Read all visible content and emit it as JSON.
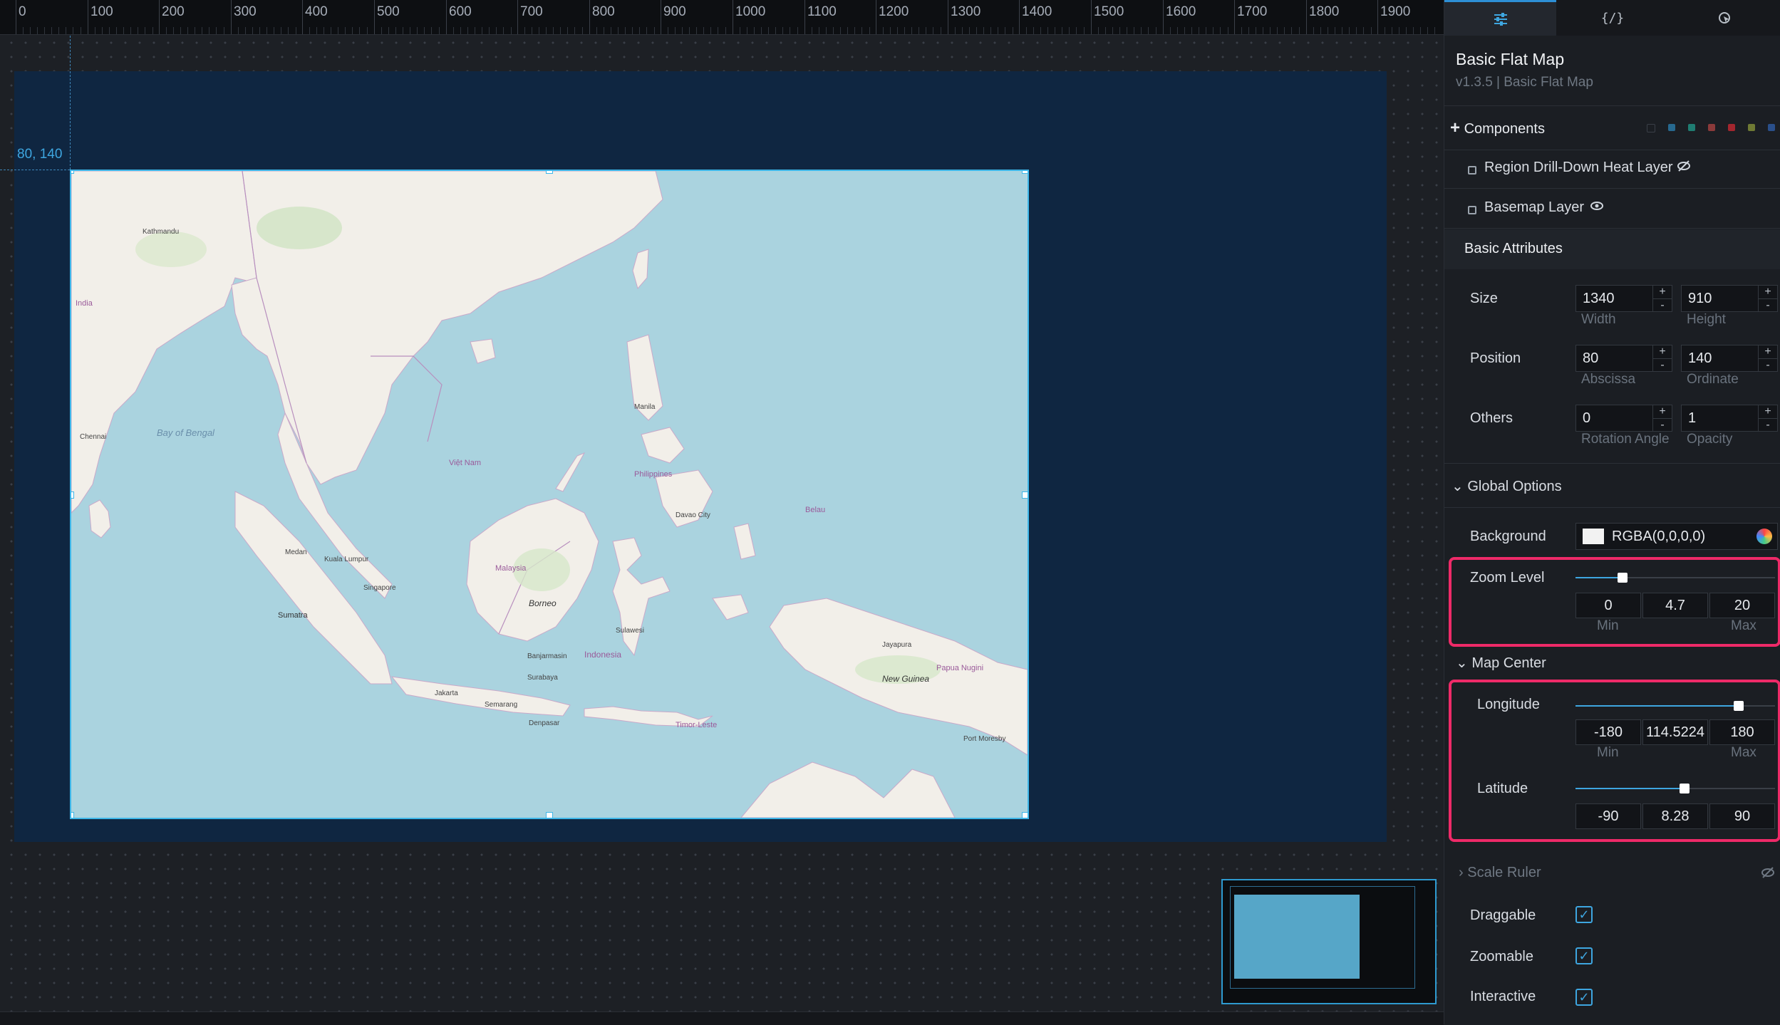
{
  "ruler": {
    "ticks": [
      "0",
      "100",
      "200",
      "300",
      "400",
      "500",
      "600",
      "700",
      "800",
      "900",
      "1000",
      "1100",
      "1200",
      "1300",
      "1400",
      "1500",
      "1600",
      "1700",
      "1800",
      "1900"
    ]
  },
  "canvas": {
    "selection_coords": "80, 140"
  },
  "map_labels": {
    "bay_of_bengal": "Bay of Bengal",
    "borneo": "Borneo",
    "malaysia": "Malaysia",
    "indonesia": "Indonesia",
    "new_guinea": "New Guinea",
    "papua_nugini": "Papua Nugini",
    "philippines": "Philippines",
    "manila": "Manila",
    "viet_nam": "Việt Nam",
    "kathmandu": "Kathmandu",
    "india": "India",
    "chennai": "Chennai",
    "jakarta": "Jakarta",
    "surabaya": "Surabaya",
    "kuala_lumpur": "Kuala Lumpur",
    "singapore": "Singapore",
    "sumatra": "Sumatra",
    "sulawesi": "Sulawesi",
    "denpasar": "Denpasar",
    "jayapura": "Jayapura",
    "port_moresby": "Port Moresby",
    "timor_leste": "Timor-Leste",
    "belau": "Belau",
    "davao": "Davao City",
    "medan": "Medan",
    "semarang": "Semarang",
    "banjarmasin": "Banjarmasin"
  },
  "panel": {
    "tabs": [
      "settings-icon",
      "code-icon",
      "interaction-icon"
    ],
    "title": "Basic Flat Map",
    "subtitle": "v1.3.5 | Basic Flat Map",
    "components_label": "Components",
    "components_add": "+",
    "layers": [
      {
        "name": "Region Drill-Down Heat Layer",
        "icon": "eye-off-icon"
      },
      {
        "name": "Basemap Layer",
        "icon": "eye-icon"
      }
    ],
    "basic_attributes": "Basic Attributes",
    "size": {
      "label": "Size",
      "width": "1340",
      "width_label": "Width",
      "height": "910",
      "height_label": "Height"
    },
    "position": {
      "label": "Position",
      "x": "80",
      "x_label": "Abscissa",
      "y": "140",
      "y_label": "Ordinate"
    },
    "others": {
      "label": "Others",
      "rotation": "0",
      "rotation_label": "Rotation Angle",
      "opacity": "1",
      "opacity_label": "Opacity"
    },
    "global_options": "Global Options",
    "background": {
      "label": "Background",
      "value": "RGBA(0,0,0,0)",
      "swatch_color": "#f2f2f2"
    },
    "zoom": {
      "label": "Zoom Level",
      "min": "0",
      "value": "4.7",
      "max": "20",
      "min_label": "Min",
      "max_label": "Max",
      "fraction": 0.235
    },
    "map_center": "Map Center",
    "longitude": {
      "label": "Longitude",
      "min": "-180",
      "value": "114.5224",
      "max": "180",
      "min_label": "Min",
      "max_label": "Max",
      "fraction": 0.818
    },
    "latitude": {
      "label": "Latitude",
      "min": "-90",
      "value": "8.28",
      "max": "90",
      "fraction": 0.546
    },
    "scale_ruler": "Scale Ruler",
    "draggable": {
      "label": "Draggable",
      "checked": true
    },
    "zoomable": {
      "label": "Zoomable",
      "checked": true
    },
    "interactive": {
      "label": "Interactive",
      "checked": true
    },
    "stepper_plus": "+",
    "stepper_minus": "-",
    "checkmark": "✓",
    "collapse_arrow": "⌄",
    "expand_arrow": "›"
  },
  "colors": {
    "accent": "#3ea6e0",
    "highlight": "#ee2a68",
    "stage_bg": "#0f2641",
    "water": "#aad3df",
    "land": "#f2efe9"
  }
}
